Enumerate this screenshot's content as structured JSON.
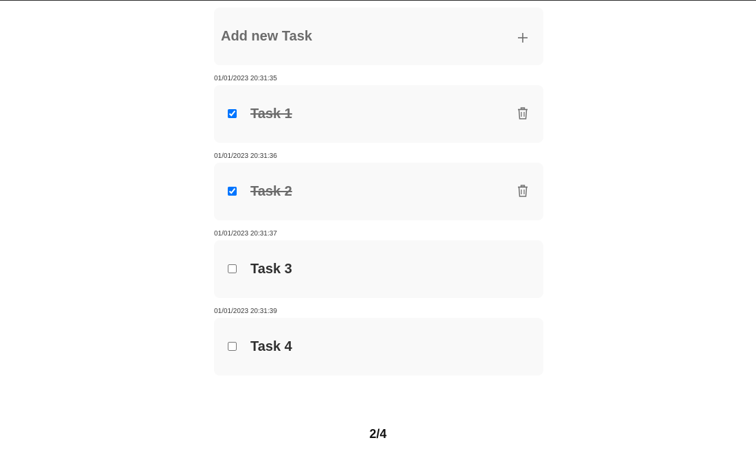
{
  "add_task": {
    "placeholder": "Add new Task",
    "add_icon": "plus-icon"
  },
  "tasks": [
    {
      "timestamp": "01/01/2023 20:31:35",
      "name": "Task 1",
      "completed": true,
      "delete_icon": "trash-icon"
    },
    {
      "timestamp": "01/01/2023 20:31:36",
      "name": "Task 2",
      "completed": true,
      "delete_icon": "trash-icon"
    },
    {
      "timestamp": "01/01/2023 20:31:37",
      "name": "Task 3",
      "completed": false
    },
    {
      "timestamp": "01/01/2023 20:31:39",
      "name": "Task 4",
      "completed": false
    }
  ],
  "pager": {
    "text": "2/4"
  },
  "colors": {
    "card_background": "#f9f9f9",
    "checkbox_accent": "#0075ff",
    "muted_text": "#6b6b6b"
  }
}
